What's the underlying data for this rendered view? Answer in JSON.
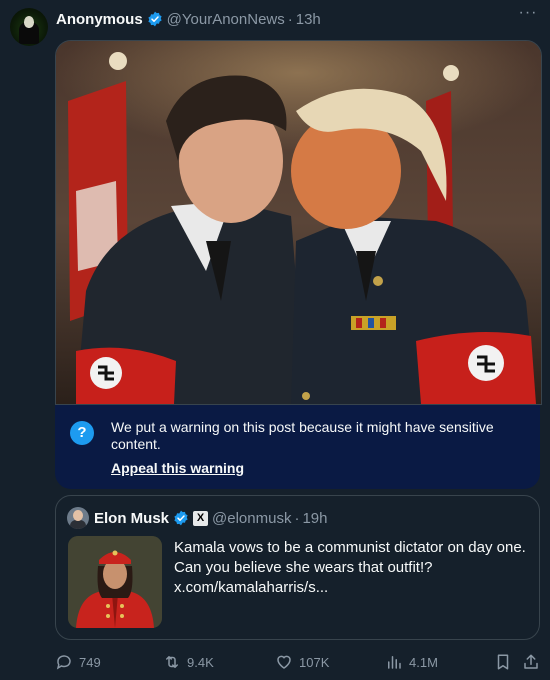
{
  "post": {
    "author_name": "Anonymous",
    "author_handle": "@YourAnonNews",
    "separator": "·",
    "time": "13h",
    "more_label": "···",
    "avatar_icon": "anonymous-mask-avatar",
    "media_description_icon": "image-icon"
  },
  "warning": {
    "info_glyph": "?",
    "text": "We put a warning on this post because it might have sensitive content.",
    "appeal_label": "Appeal this warning"
  },
  "quote": {
    "author_name": "Elon Musk",
    "author_handle": "@elonmusk",
    "separator": "·",
    "time": "19h",
    "x_badge": "X",
    "text": "Kamala vows to be a communist dictator on day one. Can you believe she wears that outfit!? x.com/kamalaharris/s..."
  },
  "actions": {
    "replies": "749",
    "reposts": "9.4K",
    "likes": "107K",
    "views": "4.1M"
  },
  "colors": {
    "background": "#15202b",
    "accent": "#1d9bf0",
    "muted": "#8b98a5",
    "warning_bg": "#0a1a44",
    "border": "#38444d"
  }
}
